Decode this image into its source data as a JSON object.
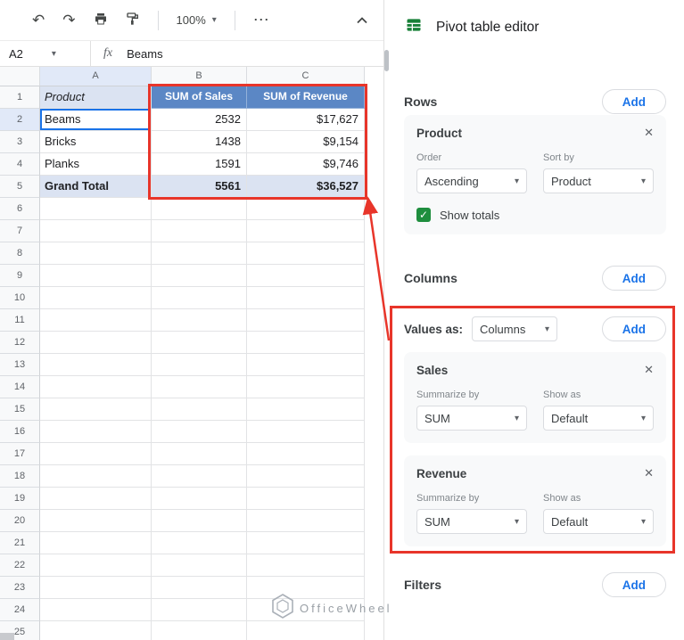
{
  "colors": {
    "accent_blue": "#1a73e8",
    "pivot_header_blue": "#5b87c5",
    "pivot_band_blue": "#dbe3f2",
    "annotation_red": "#e8352a",
    "check_green": "#1e8e3e",
    "sheets_green": "#188038"
  },
  "icons": {
    "undo": "↶",
    "redo": "↷",
    "more": "⋯",
    "dropdown": "▾",
    "close": "✕",
    "check": "✓"
  },
  "toolbar": {
    "zoom": "100%"
  },
  "formula_bar": {
    "cell_reference": "A2",
    "fx_label": "fx",
    "value": "Beams"
  },
  "spreadsheet": {
    "column_headers": [
      "A",
      "B",
      "C"
    ],
    "rows": [
      {
        "n": "1",
        "a": "Product",
        "b": "SUM of Sales",
        "c": "SUM of Revenue"
      },
      {
        "n": "2",
        "a": "Beams",
        "b": "2532",
        "c": "$17,627"
      },
      {
        "n": "3",
        "a": "Bricks",
        "b": "1438",
        "c": "$9,154"
      },
      {
        "n": "4",
        "a": "Planks",
        "b": "1591",
        "c": "$9,746"
      },
      {
        "n": "5",
        "a": "Grand Total",
        "b": "5561",
        "c": "$36,527"
      }
    ],
    "extra_row_numbers": [
      "6",
      "7",
      "8",
      "9",
      "10",
      "11",
      "12",
      "13",
      "14",
      "15",
      "16",
      "17",
      "18",
      "19",
      "20",
      "21",
      "22",
      "23",
      "24",
      "25"
    ]
  },
  "editor": {
    "title": "Pivot table editor",
    "rows_section": {
      "label": "Rows",
      "add_label": "Add",
      "card": {
        "title": "Product",
        "order_label": "Order",
        "order_value": "Ascending",
        "sort_by_label": "Sort by",
        "sort_by_value": "Product",
        "show_totals_label": "Show totals"
      }
    },
    "columns_section": {
      "label": "Columns",
      "add_label": "Add"
    },
    "values_section": {
      "values_as_label": "Values as:",
      "values_as_value": "Columns",
      "add_label": "Add",
      "cards": [
        {
          "title": "Sales",
          "summarize_label": "Summarize by",
          "summarize_value": "SUM",
          "show_as_label": "Show as",
          "show_as_value": "Default"
        },
        {
          "title": "Revenue",
          "summarize_label": "Summarize by",
          "summarize_value": "SUM",
          "show_as_label": "Show as",
          "show_as_value": "Default"
        }
      ]
    },
    "filters_section": {
      "label": "Filters",
      "add_label": "Add"
    }
  },
  "watermark": {
    "text": "OfficeWheel"
  }
}
